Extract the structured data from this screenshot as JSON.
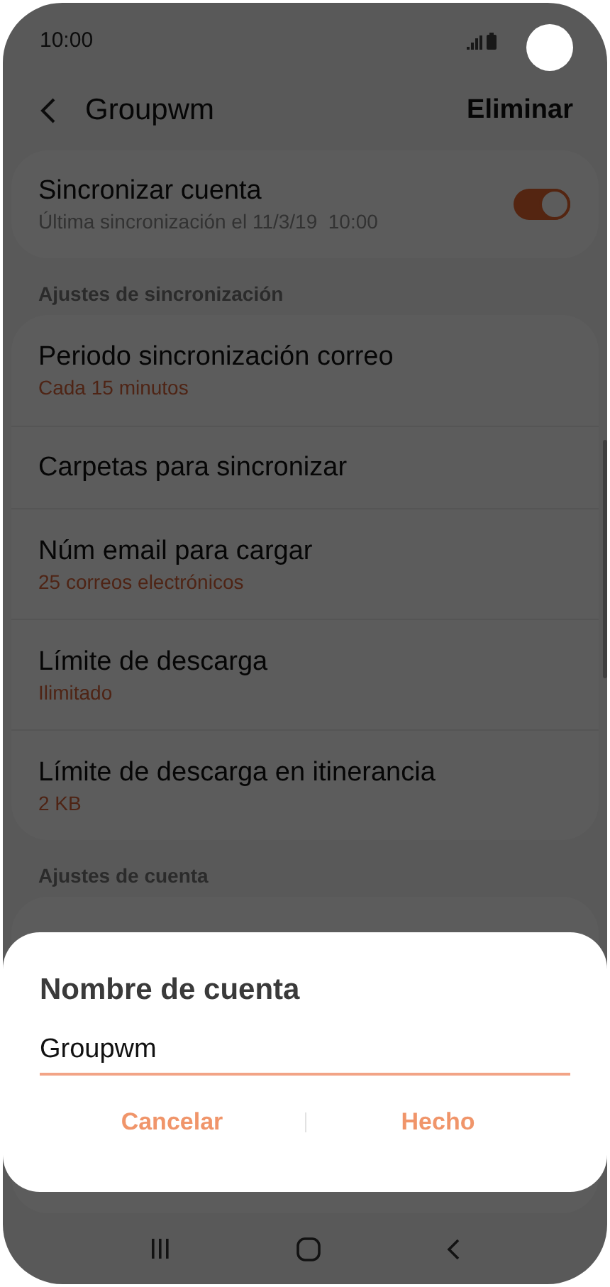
{
  "status_bar": {
    "time": "10:00"
  },
  "header": {
    "title": "Groupwm",
    "action": "Eliminar"
  },
  "sync_card": {
    "title": "Sincronizar cuenta",
    "subtitle": "Última sincronización el 11/3/19  10:00",
    "on": true
  },
  "sections": [
    {
      "heading": "Ajustes de sincronización",
      "items": [
        {
          "title": "Periodo sincronización correo",
          "value": "Cada 15 minutos"
        },
        {
          "title": "Carpetas para sincronizar"
        },
        {
          "title": "Núm email para cargar",
          "value": "25 correos electrónicos"
        },
        {
          "title": "Límite de descarga",
          "value": "Ilimitado"
        },
        {
          "title": "Límite de descarga en itinerancia",
          "value": "2 KB"
        }
      ]
    },
    {
      "heading": "Ajustes de cuenta"
    }
  ],
  "dialog": {
    "title": "Nombre de cuenta",
    "value": "Groupwm",
    "buttons": [
      "Cancelar",
      "Hecho"
    ]
  }
}
